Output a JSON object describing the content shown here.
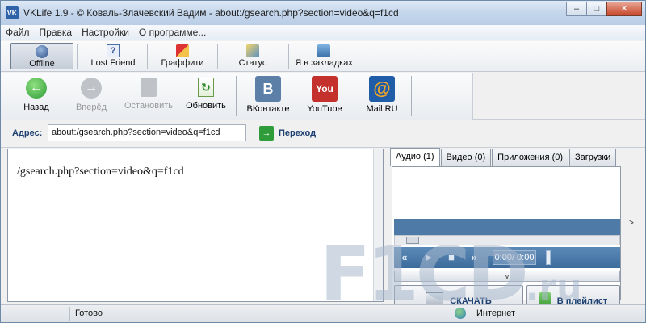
{
  "window": {
    "title": "VKLife 1.9 - © Коваль-Злачевский Вадим - about:/gsearch.php?section=video&q=f1cd",
    "icon_text": "VK",
    "minimize": "–",
    "maximize": "□",
    "close": "✕"
  },
  "menu": [
    "Файл",
    "Правка",
    "Настройки",
    "О программе..."
  ],
  "toolbar1": {
    "offline": "Offline",
    "lost_friend": "Lost Friend",
    "graffiti": "Граффити",
    "status": "Статус",
    "bookmarks": "Я в закладках"
  },
  "nav": {
    "back": "Назад",
    "forward": "Вперёд",
    "stop": "Остановить",
    "refresh": "Обновить",
    "vkontakte": "ВКонтакте",
    "youtube": "YouTube",
    "mailru": "Mail.RU",
    "vk_logo": "B",
    "youtube_logo": "You",
    "mailru_logo": "@"
  },
  "address": {
    "label": "Адрес:",
    "value": "about:/gsearch.php?section=video&q=f1cd",
    "go_label": "Переход"
  },
  "content": {
    "text": "/gsearch.php?section=video&q=f1cd"
  },
  "side_panel": {
    "tabs": [
      "Аудио (1)",
      "Видео (0)",
      "Приложения (0)",
      "Загрузки"
    ],
    "time": "0:00/ 0:00",
    "expander": "v",
    "download_button": "СКАЧАТЬ",
    "playlist_button": "В плейлист",
    "collapse_arrow": ">"
  },
  "status": {
    "text": "Готово",
    "zone": "Интернет"
  },
  "watermark": {
    "main": "F1CD",
    "suffix": ".ru"
  },
  "colors": {
    "accent": "#1d3f70",
    "player": "#4d7aa6",
    "go_green": "#2f9c3a"
  }
}
